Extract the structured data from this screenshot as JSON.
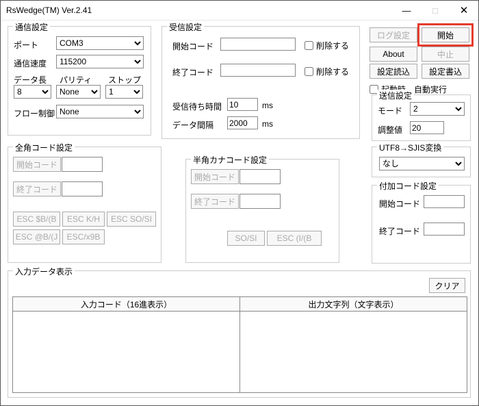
{
  "window": {
    "title": "RsWedge(TM) Ver.2.41"
  },
  "titleBtns": {
    "min": "—",
    "max": "□",
    "close": "✕"
  },
  "comm": {
    "legend": "通信設定",
    "port_lbl": "ポート",
    "port": "COM3",
    "baud_lbl": "通信速度",
    "baud": "115200",
    "data_lbl": "データ長",
    "parity_lbl": "パリティ",
    "stop_lbl": "ストップ",
    "data": "8",
    "parity": "None",
    "stop": "1",
    "flow_lbl": "フロー制御",
    "flow": "None"
  },
  "recv": {
    "legend": "受信設定",
    "start_lbl": "開始コード",
    "del1": "削除する",
    "end_lbl": "終了コード",
    "del2": "削除する",
    "wait_lbl": "受信待ち時間",
    "wait": "10",
    "ms1": "ms",
    "interval_lbl": "データ間隔",
    "interval": "2000",
    "ms2": "ms"
  },
  "rightBtns": {
    "log": "ログ設定",
    "start": "開始",
    "about": "About",
    "stop": "中止",
    "loadcfg": "設定読込",
    "savecfg": "設定書込"
  },
  "auto": {
    "chk": "起動時、自動実行"
  },
  "send": {
    "legend": "送信設定",
    "mode_lbl": "モード",
    "mode": "2",
    "adj_lbl": "調整値",
    "adj": "20"
  },
  "utf8": {
    "legend": "UTF8→SJIS変換",
    "val": "なし"
  },
  "zen": {
    "legend": "全角コード設定",
    "start": "開始コード",
    "end": "終了コード",
    "b1": "ESC $B/(B",
    "b2": "ESC K/H",
    "b3": "ESC SO/SI",
    "b4": "ESC @B/(J",
    "b5": "ESC/x9B"
  },
  "han": {
    "legend": "半角カナコード設定",
    "start": "開始コード",
    "end": "終了コード",
    "b1": "SO/SI",
    "b2": "ESC (I/(B"
  },
  "addc": {
    "legend": "付加コード設定",
    "start": "開始コード",
    "end": "終了コード"
  },
  "disp": {
    "legend": "入力データ表示",
    "clear": "クリア",
    "col1": "入力コード（16進表示）",
    "col2": "出力文字列（文字表示）"
  }
}
